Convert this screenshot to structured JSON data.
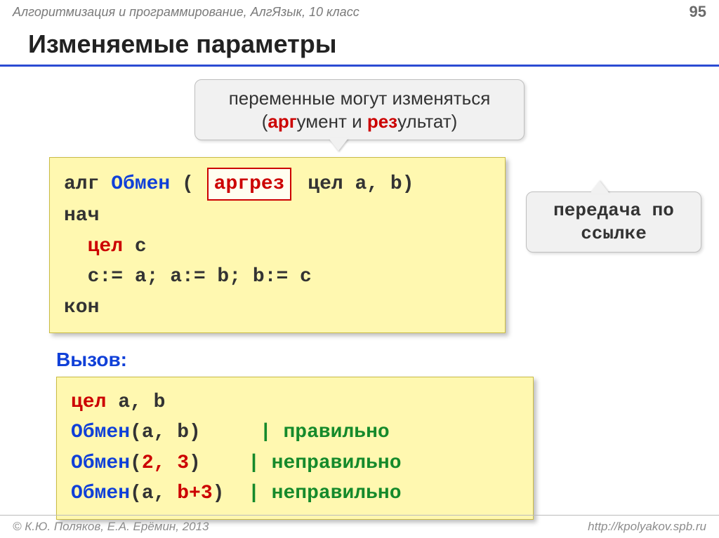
{
  "header": {
    "subject": "Алгоритмизация и программирование, АлгЯзык, 10 класс",
    "page": "95"
  },
  "title": "Изменяемые параметры",
  "callout_top": {
    "line1_pre": "переменные могут изменяться",
    "line2_open": "(",
    "line2_arg_red": "арг",
    "line2_arg_rest": "умент и ",
    "line2_res_red": "рез",
    "line2_res_rest": "ультат)"
  },
  "code1": {
    "l1_alg": "алг ",
    "l1_name": "Обмен",
    "l1_open": " ( ",
    "l1_highlight": "аргрез",
    "l1_rest": " цел a, b)",
    "l2": "нач",
    "l3_indent": "  ",
    "l3_red": "цел",
    "l3_rest": " c",
    "l4": "  c:= a; a:= b; b:= c",
    "l5": "кон"
  },
  "callout_right": {
    "line1": "передача по",
    "line2": "ссылке"
  },
  "call_label": "Вызов:",
  "code2": {
    "l1_red": "цел",
    "l1_rest": " a, b",
    "l2_blue": "Обмен",
    "l2_mid": "(a, b)     ",
    "l2_green": "| правильно",
    "l3_blue": "Обмен",
    "l3_open": "(",
    "l3_red": "2, 3",
    "l3_close": ")    ",
    "l3_green": "| неправильно",
    "l4_blue": "Обмен",
    "l4_open": "(a, ",
    "l4_red": "b+3",
    "l4_close": ")  ",
    "l4_green": "| неправильно"
  },
  "footer": {
    "left": "© К.Ю. Поляков, Е.А. Ерёмин, 2013",
    "right": "http://kpolyakov.spb.ru"
  }
}
